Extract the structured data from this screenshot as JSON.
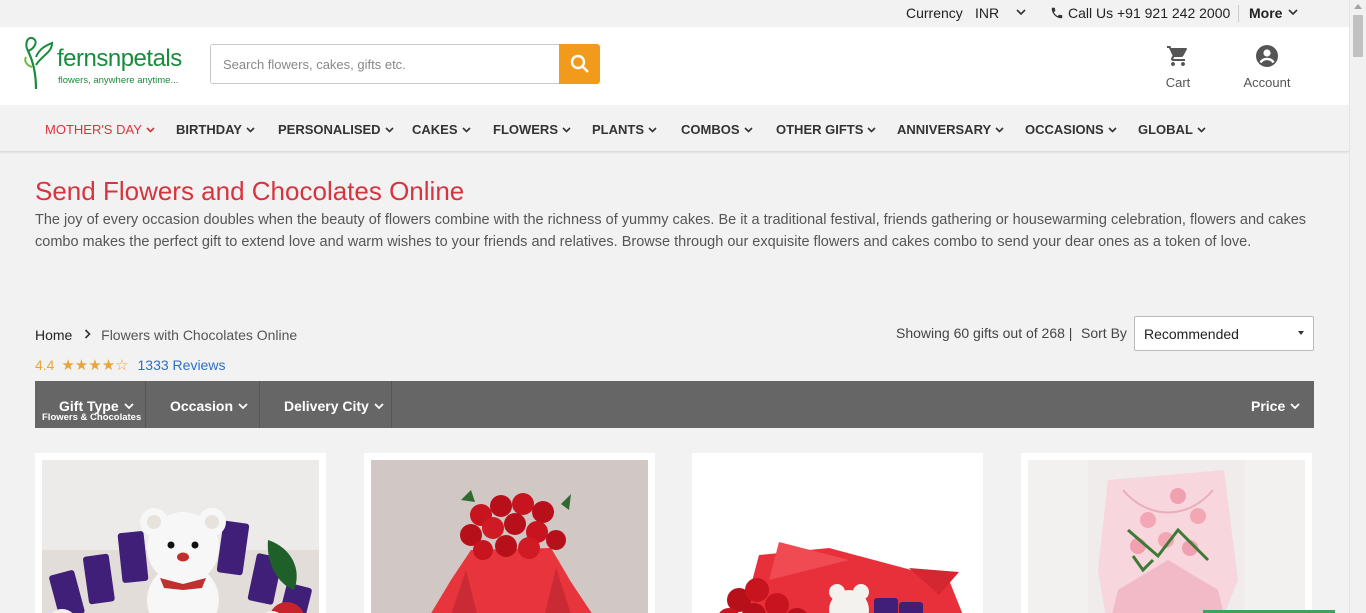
{
  "topbar": {
    "currency_label": "Currency",
    "currency_value": "INR",
    "call": "Call Us +91 921 242 2000",
    "more": "More"
  },
  "header": {
    "logo_name": "fernsnpetals",
    "logo_tagline": "flowers, anywhere anytime...",
    "search_placeholder": "Search flowers, cakes, gifts etc.",
    "cart_label": "Cart",
    "account_label": "Account"
  },
  "nav": {
    "items": [
      "MOTHER'S DAY",
      "BIRTHDAY",
      "PERSONALISED",
      "CAKES",
      "FLOWERS",
      "PLANTS",
      "COMBOS",
      "OTHER GIFTS",
      "ANNIVERSARY",
      "OCCASIONS",
      "GLOBAL"
    ]
  },
  "page": {
    "title": "Send Flowers and Chocolates Online",
    "description": "The joy of every occasion doubles when the beauty of flowers combine with the richness of yummy cakes. Be it a traditional festival, friends gathering or housewarming celebration, flowers and cakes combo makes the perfect gift to extend love and warm wishes to your friends and relatives. Browse through our exquisite flowers and cakes combo to send your dear ones as a token of love."
  },
  "breadcrumb": {
    "home": "Home",
    "current": "Flowers with Chocolates Online"
  },
  "rating": {
    "score": "4.4",
    "stars": "★★★★☆",
    "reviews_count": "1333",
    "reviews_label": "Reviews"
  },
  "listing": {
    "showing": "Showing 60 gifts out of 268 |",
    "sort_label": "Sort By",
    "sort_value": "Recommended"
  },
  "filters": {
    "gift_type": "Gift Type",
    "gift_type_selected": "Flowers & Chocolates",
    "occasion": "Occasion",
    "delivery_city": "Delivery City",
    "price": "Price"
  },
  "colors": {
    "brand_green": "#1a8b3c",
    "accent_red": "#d8343f",
    "search_orange": "#f29a1c",
    "filter_bar": "#666666",
    "link_blue": "#2f6fc7",
    "star_gold": "#e8a53a"
  }
}
